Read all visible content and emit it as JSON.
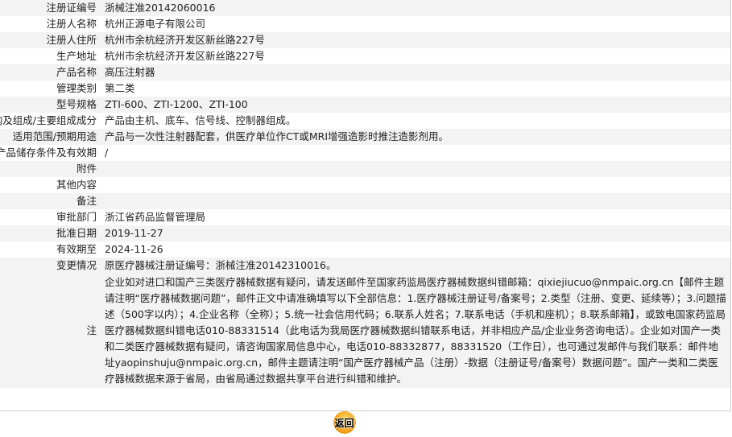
{
  "rows": [
    {
      "label": "注册证编号",
      "value": "浙械注准20142060016"
    },
    {
      "label": "注册人名称",
      "value": "杭州正源电子有限公司"
    },
    {
      "label": "注册人住所",
      "value": "杭州市余杭经济开发区新丝路227号"
    },
    {
      "label": "生产地址",
      "value": "杭州市余杭经济开发区新丝路227号"
    },
    {
      "label": "产品名称",
      "value": "高压注射器"
    },
    {
      "label": "管理类别",
      "value": "第二类"
    },
    {
      "label": "型号规格",
      "value": "ZTI-600、ZTI-1200、ZTI-100"
    },
    {
      "label": "结构及组成/主要组成成分",
      "value": "产品由主机、底车、信号线、控制器组成。"
    },
    {
      "label": "适用范围/预期用途",
      "value": "产品与一次性注射器配套，供医疗单位作CT或MRI增强造影时推注造影剂用。"
    },
    {
      "label": "产品储存条件及有效期",
      "value": "/"
    },
    {
      "label": "附件",
      "value": ""
    },
    {
      "label": "其他内容",
      "value": ""
    },
    {
      "label": "备注",
      "value": ""
    },
    {
      "label": "审批部门",
      "value": "浙江省药品监督管理局"
    },
    {
      "label": "批准日期",
      "value": "2019-11-27"
    },
    {
      "label": "有效期至",
      "value": "2024-11-26"
    },
    {
      "label": "变更情况",
      "value": "原医疗器械注册证编号：浙械注准20142310016。"
    }
  ],
  "notes": {
    "label": "注",
    "value": "企业如对进口和国产三类医疗器械数据有疑问，请发送邮件至国家药监局医疗器械数据纠错邮箱：qixiejiucuo@nmpaic.org.cn【邮件主题请注明“医疗器械数据问题”，邮件正文中请准确填写以下全部信息：1.医疗器械注册证号/备案号；2.类型（注册、变更、延续等）；3.问题描述（500字以内）；4.企业名称（全称）；5.统一社会信用代码；6.联系人姓名；7.联系电话（手机和座机）；8.联系邮箱】，或致电国家药监局医疗器械数据纠错电话010-88331514（此电话为我局医疗器械数据纠错联系电话，并非相应产品/企业业务咨询电话）。企业如对国产一类和二类医疗器械数据有疑问，请咨询国家局信息中心，电话010-88332877，88331520（工作日），也可通过发邮件与我们联系：邮件地址yaopinshuju@nmpaic.org.cn，邮件主题请注明“国产医疗器械产品（注册）-数据（注册证号/备案号）数据问题”。国产一类和二类医疗器械数据来源于省局，由省局通过数据共享平台进行纠错和维护。"
  },
  "back_button": {
    "label": "返回"
  },
  "colors": {
    "row_odd": "#f3f3f3",
    "row_even": "#ffffff",
    "button": "#f5a623"
  }
}
